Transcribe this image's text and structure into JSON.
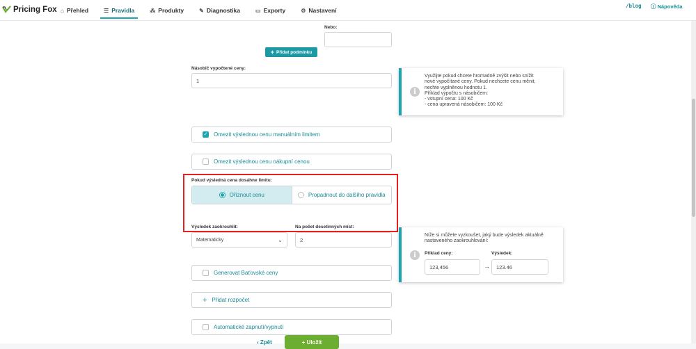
{
  "app": {
    "name": "Pricing Fox"
  },
  "nav": [
    {
      "label": "Přehled",
      "icon": "home-icon",
      "glyph": "⌂"
    },
    {
      "label": "Pravidla",
      "icon": "list-icon",
      "glyph": "☰"
    },
    {
      "label": "Produkty",
      "icon": "products-icon",
      "glyph": "⁂"
    },
    {
      "label": "Diagnostika",
      "icon": "diagnostics-icon",
      "glyph": "✎"
    },
    {
      "label": "Exporty",
      "icon": "export-icon",
      "glyph": "▭"
    },
    {
      "label": "Nastavení",
      "icon": "gear-icon",
      "glyph": "⚙"
    }
  ],
  "header_links": {
    "blog": "/blog",
    "help": "Nápověda"
  },
  "condition": {
    "or_label": "Nebo:",
    "or_value": "",
    "add_button": "Přidat podmínku"
  },
  "multiplier": {
    "label": "Násobič vypočtené ceny:",
    "value": "1",
    "info_lines": [
      "Využijte pokud chcete hromadně zvýšit nebo snížit",
      "nové vypočítané ceny. Pokud nechcete cenu měnit,",
      "nechte vyplněnou hodnotu 1.",
      "Příklad výpočtu s násobičem:",
      "- vstupní cena: 100 Kč",
      "- cena upravená násobičem: 100 Kč"
    ]
  },
  "limits": {
    "manual": {
      "label": "Omezit výslednou cenu manuálním limitem",
      "checked": true
    },
    "purchase": {
      "label": "Omezit výslednou cenu nákupní cenou",
      "checked": false
    }
  },
  "limit_reached": {
    "label": "Pokud výsledná cena dosáhne limitu:",
    "options": [
      {
        "label": "Oříznout cenu",
        "selected": true
      },
      {
        "label": "Propadnout do dalšího pravidla",
        "selected": false
      }
    ]
  },
  "rounding": {
    "label": "Výsledek zaokrouhlit:",
    "value": "Matematicky",
    "decimals_label": "Na počet desetinných míst:",
    "decimals_value": "2",
    "info_lines": [
      "Níže si můžete vyzkoušet, jaký bude výsledek aktuálně",
      "nastaveného zaokrouhlování:"
    ],
    "example_label": "Příklad ceny:",
    "example_value": "123,456",
    "result_label": "Výsledek:",
    "result_value": "123.46",
    "arrow": "→"
  },
  "extra": {
    "bata": {
      "label": "Generovat Baťovské ceny",
      "checked": false
    },
    "budget": {
      "label": "Přidat rozpočet"
    },
    "auto": {
      "label": "Automatické zapnutí/vypnutí",
      "checked": false
    }
  },
  "footer": {
    "back": "‹ Zpět",
    "save": "+ Uložit"
  },
  "colors": {
    "accent": "#1ca5b0",
    "highlight": "#e5211f",
    "save": "#6cae2f"
  }
}
